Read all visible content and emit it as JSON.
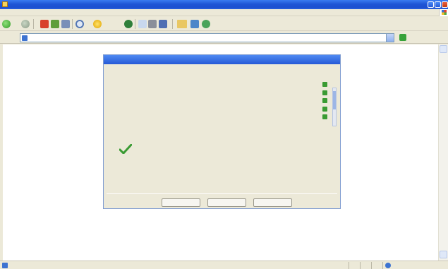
{
  "window": {
    "title": ""
  },
  "menu": {
    "items": [
      "",
      "",
      "",
      "",
      "",
      ""
    ]
  },
  "toolbar": {
    "back_label": "",
    "search_label": "",
    "favorites_label": ""
  },
  "address": {
    "label": "",
    "value": "",
    "go_label": "",
    "links_label": ""
  },
  "dialog": {
    "title": "",
    "section_heading": "",
    "options": [
      {
        "name": "",
        "value": ""
      },
      {
        "name": "",
        "value": ""
      },
      {
        "name": "",
        "value": ""
      },
      {
        "name": "",
        "value": ""
      },
      {
        "name": "",
        "value": ""
      }
    ],
    "status_text": "",
    "buttons": {
      "back": "",
      "next": "",
      "finish": ""
    }
  },
  "statusbar": {
    "zone": ""
  },
  "colors": {
    "titlebar": "#2559d6",
    "chrome": "#ece9d8",
    "dialog_titlebar": "#2e62d9",
    "accent_green": "#3a9b33"
  },
  "icons": [
    "ie-page-icon",
    "back-icon",
    "forward-icon",
    "stop-icon",
    "refresh-icon",
    "home-icon",
    "search-icon",
    "favorites-icon",
    "media-icon",
    "mail-icon",
    "print-icon",
    "edit-icon",
    "folder-icon",
    "discuss-icon",
    "messenger-icon",
    "go-icon",
    "arrow-icon",
    "check-icon",
    "zone-icon"
  ]
}
